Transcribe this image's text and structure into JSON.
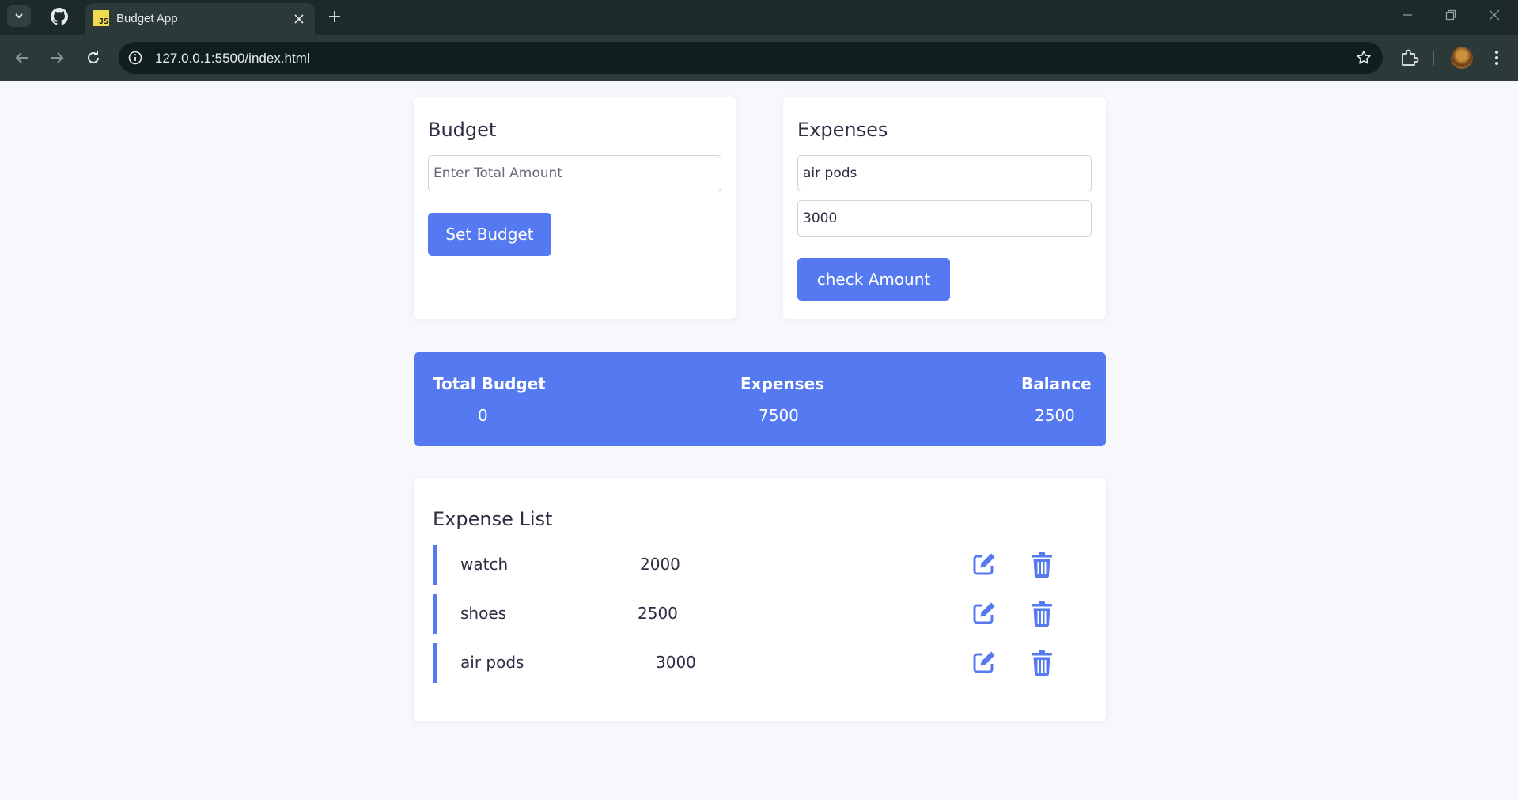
{
  "browser": {
    "tab_title": "Budget App",
    "tab_favicon_text": "JS",
    "url": "127.0.0.1:5500/index.html"
  },
  "budget_card": {
    "heading": "Budget",
    "amount_placeholder": "Enter Total Amount",
    "amount_value": "",
    "button_label": "Set Budget"
  },
  "expenses_card": {
    "heading": "Expenses",
    "title_value": "air pods",
    "amount_value": "3000",
    "button_label": "check Amount"
  },
  "summary": {
    "total_budget_label": "Total Budget",
    "total_budget_value": "0",
    "expenses_label": "Expenses",
    "expenses_value": "7500",
    "balance_label": "Balance",
    "balance_value": "2500"
  },
  "expense_list": {
    "heading": "Expense List",
    "items": [
      {
        "name": "watch",
        "amount": "2000"
      },
      {
        "name": "shoes",
        "amount": "2500"
      },
      {
        "name": "air pods",
        "amount": "3000"
      }
    ]
  },
  "colors": {
    "accent": "#5479f0",
    "page_bg": "#f7f8fc",
    "chrome_bg": "#1c2b2a",
    "text": "#2b2d42"
  },
  "icons": {
    "row_edit": "edit-icon",
    "row_delete": "trash-icon"
  }
}
